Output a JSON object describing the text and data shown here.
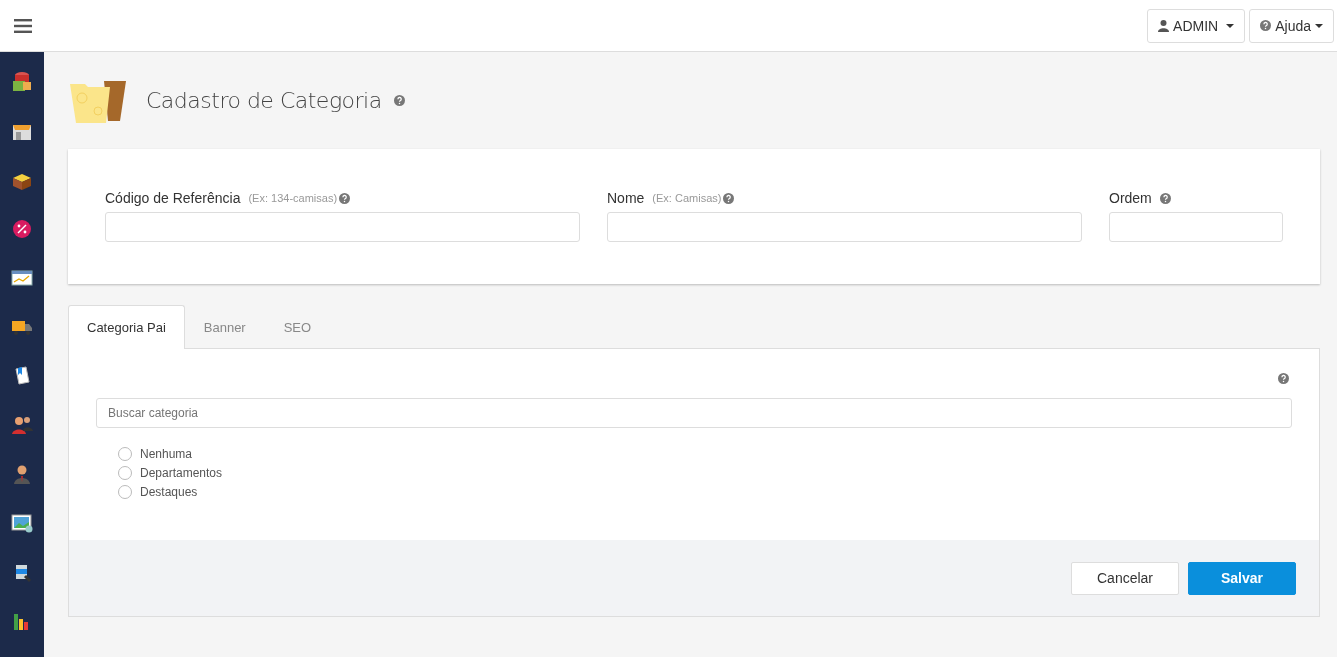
{
  "header": {
    "user_menu": "ADMIN",
    "help_menu": "Ajuda"
  },
  "sidebar": {
    "items": [
      {
        "kind": "database"
      },
      {
        "kind": "store"
      },
      {
        "kind": "box"
      },
      {
        "kind": "percent"
      },
      {
        "kind": "chart"
      },
      {
        "kind": "truck"
      },
      {
        "kind": "document"
      },
      {
        "kind": "people"
      },
      {
        "kind": "person"
      },
      {
        "kind": "image"
      },
      {
        "kind": "paint"
      },
      {
        "kind": "bars"
      }
    ]
  },
  "page": {
    "title": "Cadastro de Categoria"
  },
  "form": {
    "fields": [
      {
        "label": "Código de Referência",
        "hint": "(Ex: 134-camisas)"
      },
      {
        "label": "Nome",
        "hint": "(Ex: Camisas)"
      },
      {
        "label": "Ordem"
      }
    ]
  },
  "tabs": [
    {
      "label": "Categoria Pai",
      "selected": true
    },
    {
      "label": "Banner",
      "selected": false
    },
    {
      "label": "SEO",
      "selected": false
    }
  ],
  "search": {
    "placeholder": "Buscar categoria"
  },
  "categories": [
    {
      "label": "Nenhuma",
      "selected": false
    },
    {
      "label": "Departamentos",
      "selected": false
    },
    {
      "label": "Destaques",
      "selected": false
    }
  ],
  "buttons": [
    {
      "label": "Cancelar",
      "kind": "secondary"
    },
    {
      "label": "Salvar",
      "kind": "primary"
    }
  ]
}
